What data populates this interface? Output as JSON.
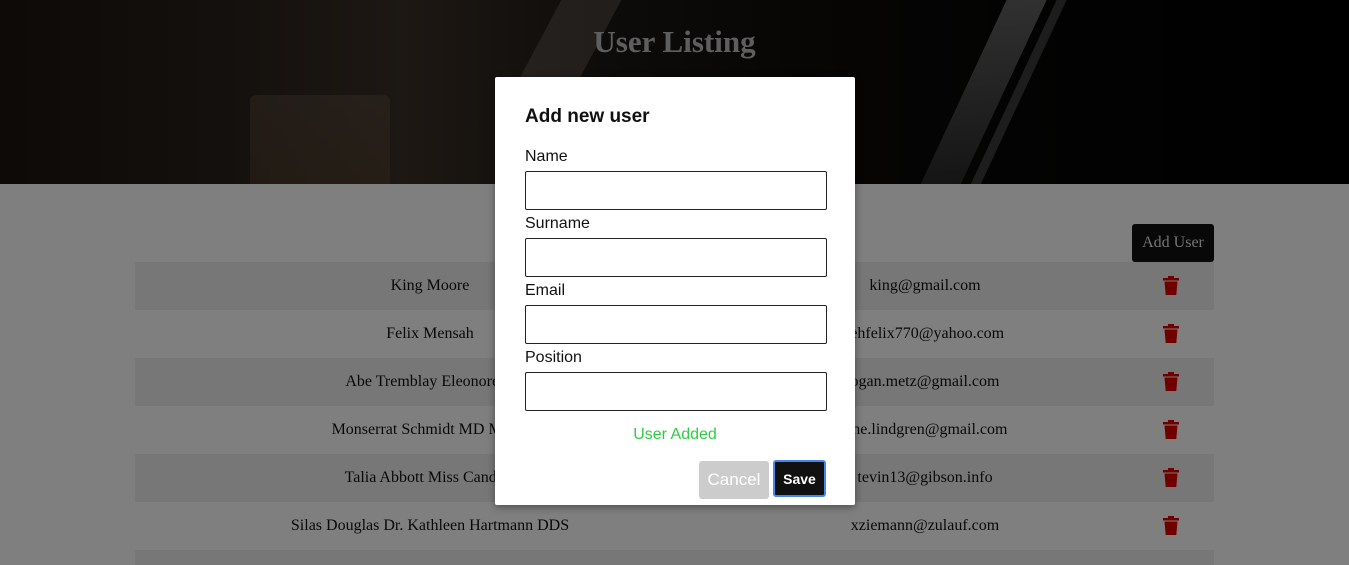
{
  "header": {
    "title": "User Listing"
  },
  "toolbar": {
    "add_user_label": "Add User"
  },
  "users": [
    {
      "name": "King Moore",
      "email": "king@gmail.com"
    },
    {
      "name": "Felix Mensah",
      "email": "tehfelix770@yahoo.com"
    },
    {
      "name": "Abe Tremblay Eleonore K",
      "email": "ogan.metz@gmail.com"
    },
    {
      "name": "Monserrat Schmidt MD Madis",
      "email": "rine.lindgren@gmail.com"
    },
    {
      "name": "Talia Abbott Miss Candice",
      "email": "tevin13@gibson.info"
    },
    {
      "name": "Silas Douglas Dr. Kathleen Hartmann DDS",
      "email": "xziemann@zulauf.com"
    }
  ],
  "icons": {
    "delete": "trash-icon",
    "delete_color": "#e00000"
  },
  "modal": {
    "title": "Add new user",
    "fields": {
      "name": {
        "label": "Name",
        "value": ""
      },
      "surname": {
        "label": "Surname",
        "value": ""
      },
      "email": {
        "label": "Email",
        "value": ""
      },
      "position": {
        "label": "Position",
        "value": ""
      }
    },
    "status": "User Added",
    "status_color": "#2ecc40",
    "cancel_label": "Cancel",
    "save_label": "Save"
  }
}
